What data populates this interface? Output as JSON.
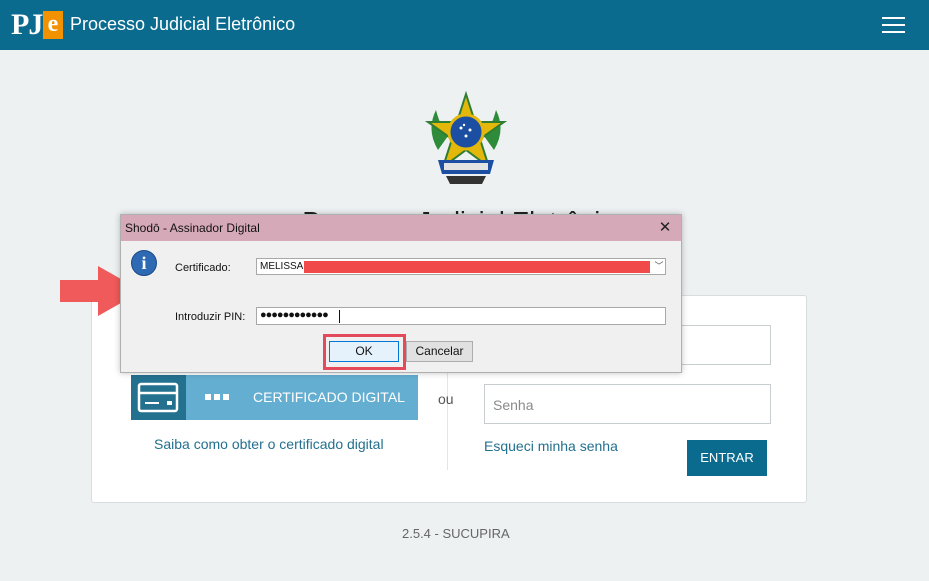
{
  "header": {
    "logo_pj": "PJ",
    "logo_e": "e",
    "title": "Processo Judicial Eletrônico"
  },
  "page": {
    "big_title": "Processo Judicial Eletrônico",
    "version": "2.5.4 - SUCUPIRA"
  },
  "login": {
    "cert_button_label": "CERTIFICADO DIGITAL",
    "or_label": "ou",
    "cert_help_link": "Saiba como obter o certificado digital",
    "password_placeholder": "Senha",
    "forgot_password_link": "Esqueci minha senha",
    "submit_label": "ENTRAR"
  },
  "dialog": {
    "title": "Shodō - Assinador Digital",
    "close_glyph": "✕",
    "certificate_label": "Certificado:",
    "certificate_value": "MELISSA",
    "pin_label": "Introduzir PIN:",
    "pin_value": "●●●●●●●●●●●●",
    "ok_label": "OK",
    "cancel_label": "Cancelar"
  },
  "colors": {
    "header_bg": "#0a6b8f",
    "accent_orange": "#f39200",
    "cert_button": "#63aed1",
    "highlight_red": "#e34a5b",
    "arrow_red": "#f05a5a"
  }
}
